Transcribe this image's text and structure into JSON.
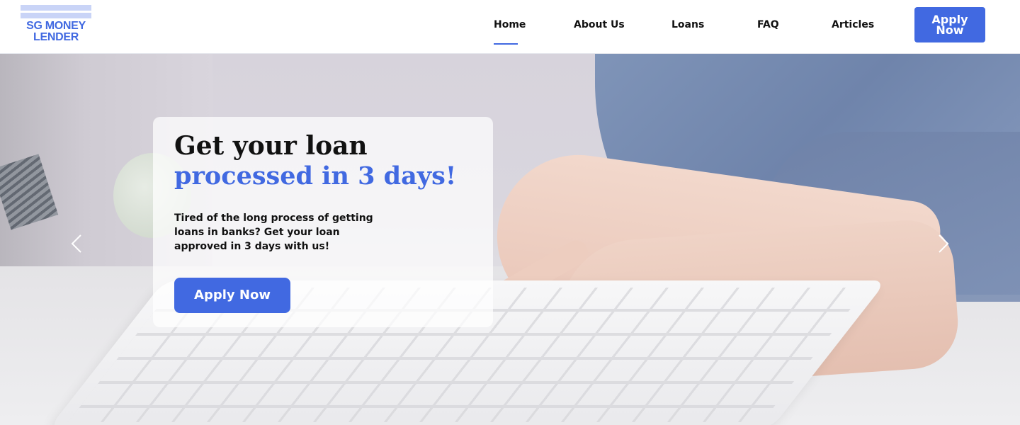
{
  "brand": {
    "logo_line1": "SG MONEY",
    "logo_line2": "LENDER",
    "color": "#4169e1"
  },
  "nav": {
    "items": [
      {
        "label": "Home",
        "active": true
      },
      {
        "label": "About Us",
        "active": false
      },
      {
        "label": "Loans",
        "active": false
      },
      {
        "label": "FAQ",
        "active": false
      },
      {
        "label": "Articles",
        "active": false
      }
    ],
    "apply_line1": "Apply",
    "apply_line2": "Now"
  },
  "hero": {
    "title_line1": "Get your loan",
    "title_line2": "processed in 3 days!",
    "description": "Tired of the long process of getting loans in banks? Get your loan approved in 3 days with us!",
    "cta_label": "Apply Now",
    "prev_icon": "chevron-left-icon",
    "next_icon": "chevron-right-icon"
  }
}
